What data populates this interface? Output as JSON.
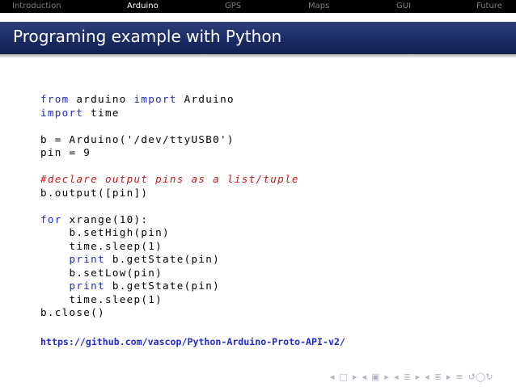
{
  "nav": {
    "items": [
      {
        "label": "Introduction",
        "active": false
      },
      {
        "label": "Arduino",
        "active": true
      },
      {
        "label": "GPS",
        "active": false
      },
      {
        "label": "Maps",
        "active": false
      },
      {
        "label": "GUI",
        "active": false
      },
      {
        "label": "Future",
        "active": false
      }
    ]
  },
  "slide": {
    "title": "Programing example with Python",
    "code": {
      "l1_from": "from",
      "l1_mid": " arduino ",
      "l1_import": "import",
      "l1_end": " Arduino",
      "l2_import": "import",
      "l2_end": " time",
      "l4": "b = Arduino('/dev/ttyUSB0')",
      "l5": "pin = 9",
      "l7_comment": "#declare output pins as a list/tuple",
      "l8": "b.output([pin])",
      "l10_for": "for",
      "l10_end": " xrange(10):",
      "l11": "    b.setHigh(pin)",
      "l12": "    time.sleep(1)",
      "l13_indent": "    ",
      "l13_print": "print",
      "l13_end": " b.getState(pin)",
      "l14": "    b.setLow(pin)",
      "l15_indent": "    ",
      "l15_print": "print",
      "l15_end": " b.getState(pin)",
      "l16": "    time.sleep(1)",
      "l17": "b.close()"
    },
    "link": "https://github.com/vascop/Python-Arduino-Proto-API-v2/"
  },
  "beamer_nav": {
    "icons": [
      "◂",
      "□",
      "▸",
      "◂",
      "▣",
      "▸",
      "◂",
      "≣",
      "▸",
      "◂",
      "≣",
      "▸",
      "≡",
      "↺◯↻"
    ]
  },
  "colors": {
    "keyword": "#1d2ad0",
    "comment": "#c61a1a",
    "title_bar": "#1a2a62",
    "nav_bg": "#000000"
  }
}
